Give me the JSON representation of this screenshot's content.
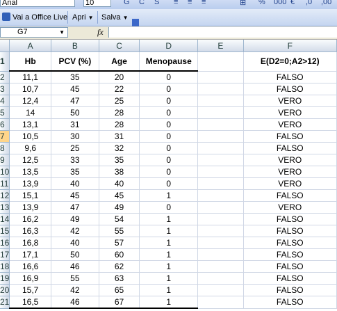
{
  "toolbar_top": {
    "font_name": "Arial",
    "font_size": "10"
  },
  "toolbar_live": {
    "office_live_label": "Vai a Office Live",
    "open_label": "Apri",
    "save_label": "Salva"
  },
  "formula_bar": {
    "name_box": "G7",
    "fx_label": "fx",
    "formula": ""
  },
  "columns": [
    "A",
    "B",
    "C",
    "D",
    "E",
    "F"
  ],
  "header_row": {
    "row_num": "1",
    "cells": [
      "Hb",
      "PCV (%)",
      "Age",
      "Menopause",
      "",
      "E(D2=0;A2>12)"
    ]
  },
  "rows": [
    {
      "num": "2",
      "cells": [
        "11,1",
        "35",
        "20",
        "0",
        "",
        "FALSO"
      ]
    },
    {
      "num": "3",
      "cells": [
        "10,7",
        "45",
        "22",
        "0",
        "",
        "FALSO"
      ]
    },
    {
      "num": "4",
      "cells": [
        "12,4",
        "47",
        "25",
        "0",
        "",
        "VERO"
      ]
    },
    {
      "num": "5",
      "cells": [
        "14",
        "50",
        "28",
        "0",
        "",
        "VERO"
      ]
    },
    {
      "num": "6",
      "cells": [
        "13,1",
        "31",
        "28",
        "0",
        "",
        "VERO"
      ]
    },
    {
      "num": "7",
      "cells": [
        "10,5",
        "30",
        "31",
        "0",
        "",
        "FALSO"
      ]
    },
    {
      "num": "8",
      "cells": [
        "9,6",
        "25",
        "32",
        "0",
        "",
        "FALSO"
      ]
    },
    {
      "num": "9",
      "cells": [
        "12,5",
        "33",
        "35",
        "0",
        "",
        "VERO"
      ]
    },
    {
      "num": "10",
      "cells": [
        "13,5",
        "35",
        "38",
        "0",
        "",
        "VERO"
      ]
    },
    {
      "num": "11",
      "cells": [
        "13,9",
        "40",
        "40",
        "0",
        "",
        "VERO"
      ]
    },
    {
      "num": "12",
      "cells": [
        "15,1",
        "45",
        "45",
        "1",
        "",
        "FALSO"
      ]
    },
    {
      "num": "13",
      "cells": [
        "13,9",
        "47",
        "49",
        "0",
        "",
        "VERO"
      ]
    },
    {
      "num": "14",
      "cells": [
        "16,2",
        "49",
        "54",
        "1",
        "",
        "FALSO"
      ]
    },
    {
      "num": "15",
      "cells": [
        "16,3",
        "42",
        "55",
        "1",
        "",
        "FALSO"
      ]
    },
    {
      "num": "16",
      "cells": [
        "16,8",
        "40",
        "57",
        "1",
        "",
        "FALSO"
      ]
    },
    {
      "num": "17",
      "cells": [
        "17,1",
        "50",
        "60",
        "1",
        "",
        "FALSO"
      ]
    },
    {
      "num": "18",
      "cells": [
        "16,6",
        "46",
        "62",
        "1",
        "",
        "FALSO"
      ]
    },
    {
      "num": "19",
      "cells": [
        "16,9",
        "55",
        "63",
        "1",
        "",
        "FALSO"
      ]
    },
    {
      "num": "20",
      "cells": [
        "15,7",
        "42",
        "65",
        "1",
        "",
        "FALSO"
      ]
    },
    {
      "num": "21",
      "cells": [
        "16,5",
        "46",
        "67",
        "1",
        "",
        "FALSO"
      ]
    }
  ],
  "selected_row": "7",
  "colors": {
    "header_bg": "#d3dbe9",
    "selected_row_header": "#ffd58a",
    "gridline": "#d0d7e5"
  }
}
